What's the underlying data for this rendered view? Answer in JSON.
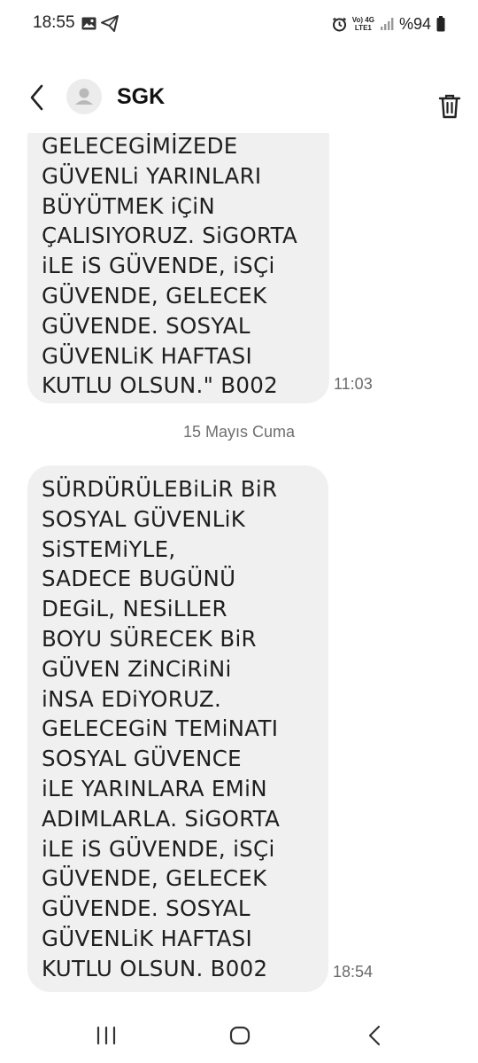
{
  "status_bar": {
    "time": "18:55",
    "network_top": "Vo) 4G",
    "network_bottom": "LTE1",
    "battery": "%94",
    "icons": [
      "image-icon",
      "send-icon",
      "alarm-icon",
      "signal-icon",
      "battery-icon"
    ]
  },
  "header": {
    "contact_name": "SGK",
    "icons": [
      "back-icon",
      "avatar-icon",
      "trash-icon"
    ]
  },
  "thread": {
    "messages": [
      {
        "text": "GELECEGİMİZEDE\nGÜVENLi YARINLARI\nBÜYÜTMEK iÇiN\nÇALISIYORUZ. SiGORTA\niLE iS GÜVENDE, iSÇi\nGÜVENDE, GELECEK\nGÜVENDE. SOSYAL\nGÜVENLiK HAFTASI\nKUTLU OLSUN.\" B002",
        "time": "11:03"
      },
      {
        "text": "SÜRDÜRÜLEBiLiR BiR\nSOSYAL GÜVENLiK\nSiSTEMiYLE,\nSADECE BUGÜNÜ\nDEGiL, NESiLLER\nBOYU SÜRECEK BiR\nGÜVEN ZiNCiRiNi\niNSA EDiYORUZ.\nGELECEGiN TEMiNATI\nSOSYAL GÜVENCE\niLE YARINLARA EMiN\nADIMLARLA. SiGORTA\niLE iS GÜVENDE, iSÇi\nGÜVENDE, GELECEK\nGÜVENDE. SOSYAL\nGÜVENLiK HAFTASI\nKUTLU OLSUN. B002",
        "time": "18:54"
      }
    ],
    "date_separator": "15 Mayıs Cuma"
  },
  "nav_bar": {
    "icons": [
      "recent-apps-icon",
      "home-icon",
      "back-nav-icon"
    ]
  },
  "colors": {
    "bubble": "#f0f0f0",
    "text": "#1f1f1f",
    "muted": "#6b6b6b"
  }
}
